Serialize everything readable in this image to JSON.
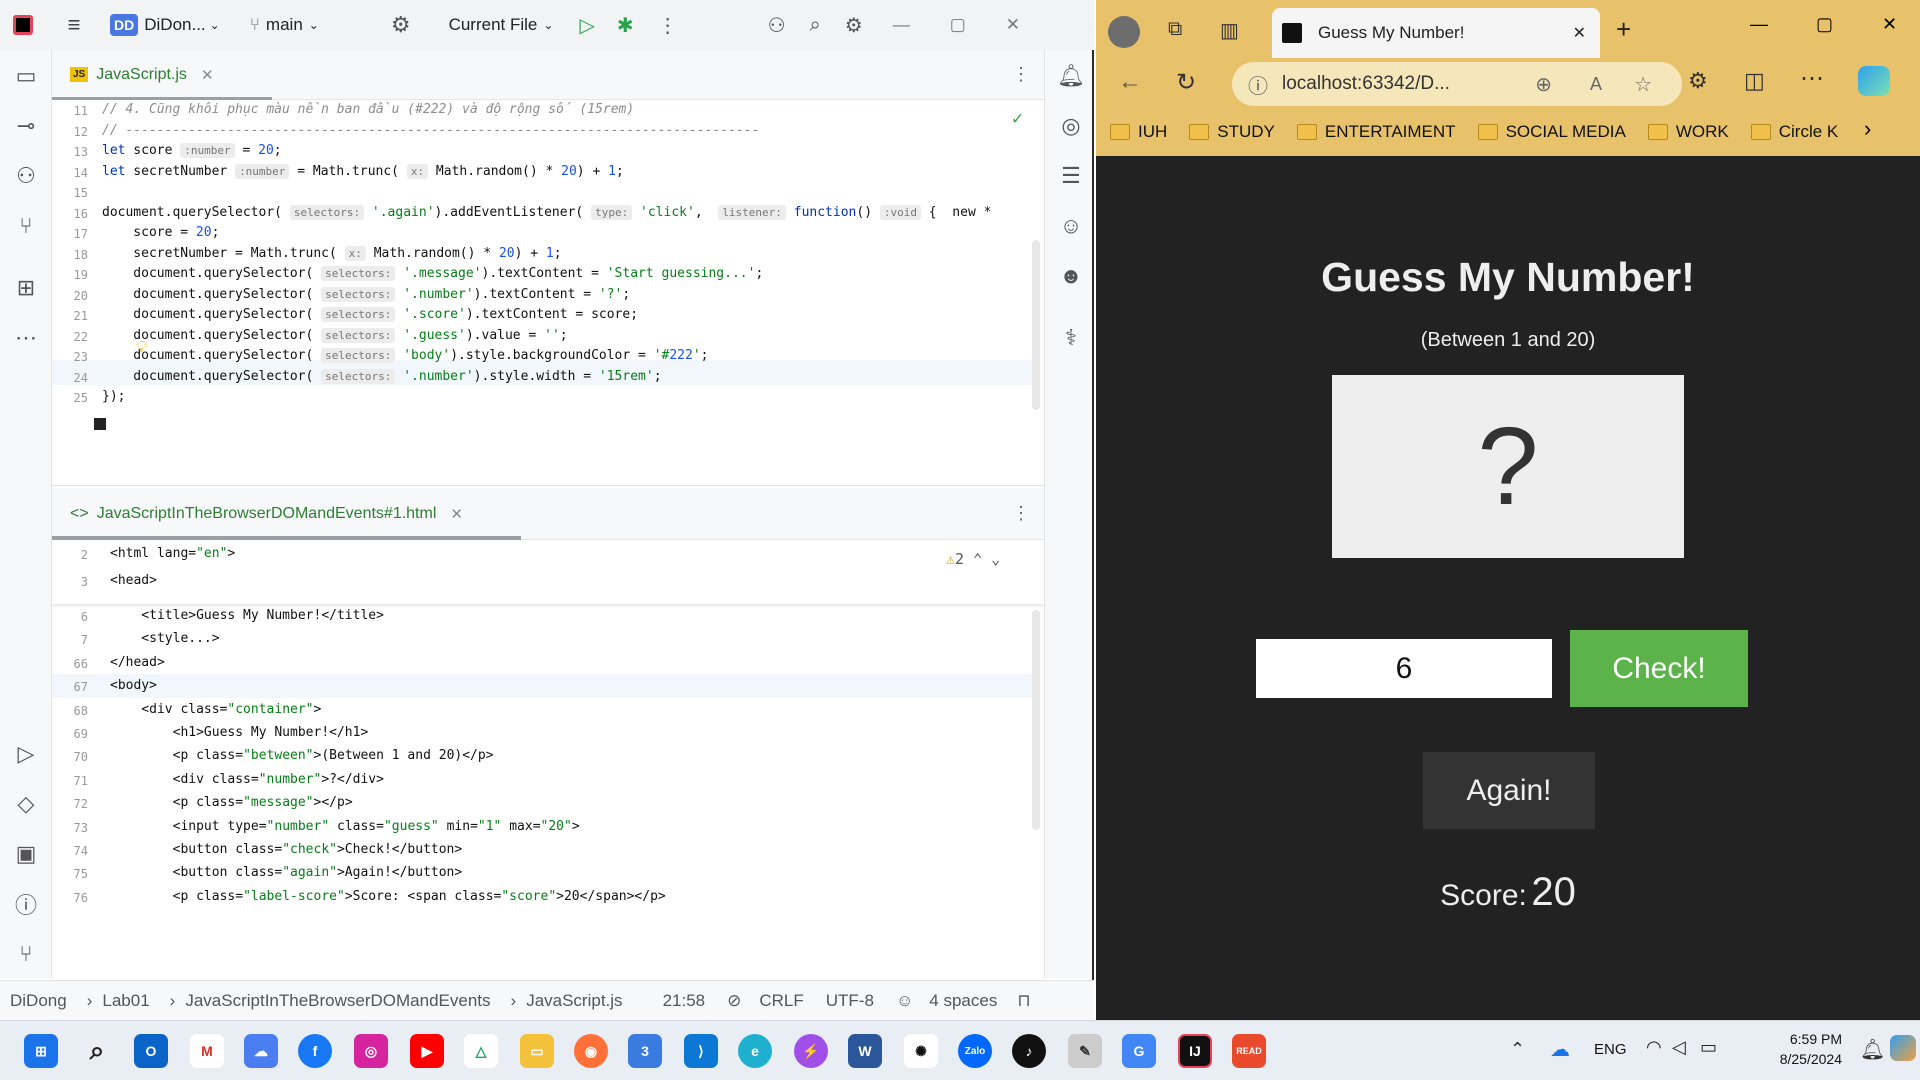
{
  "ide": {
    "project": "DiDon...",
    "project_badge": "DD",
    "branch": "main",
    "run_config": "Current File",
    "editor_tab": "JavaScript.js",
    "editor_tab_badge": "JS",
    "html_tab": "JavaScriptInTheBrowserDOMandEvents#1.html",
    "warnings": "2",
    "js_lines": [
      {
        "n": "11",
        "text": "// 4. Cũng khôi phục màu nền ban đầu (#222) và độ rộng số (15rem)"
      },
      {
        "n": "12",
        "text": "// ---------------------------------------------------------------------------------"
      },
      {
        "n": "13",
        "text": "let score :number = 20;"
      },
      {
        "n": "14",
        "text": "let secretNumber :number = Math.trunc( x: Math.random() * 20) + 1;"
      },
      {
        "n": "15",
        "text": ""
      },
      {
        "n": "16",
        "text": "document.querySelector( selectors: '.again').addEventListener( type: 'click',  listener: function() :void {  new *"
      },
      {
        "n": "17",
        "text": "    score = 20;"
      },
      {
        "n": "18",
        "text": "    secretNumber = Math.trunc( x: Math.random() * 20) + 1;"
      },
      {
        "n": "19",
        "text": "    document.querySelector( selectors: '.message').textContent = 'Start guessing...';"
      },
      {
        "n": "20",
        "text": "    document.querySelector( selectors: '.number').textContent = '?';"
      },
      {
        "n": "21",
        "text": "    document.querySelector( selectors: '.score').textContent = score;"
      },
      {
        "n": "22",
        "text": "    document.querySelector( selectors: '.guess').value = '';"
      },
      {
        "n": "23",
        "text": "    document.querySelector( selectors: 'body').style.backgroundColor = '#222';"
      },
      {
        "n": "24",
        "text": "    document.querySelector( selectors: '.number').style.width = '15rem';"
      },
      {
        "n": "25",
        "text": "});"
      }
    ],
    "html_lines": [
      {
        "n": "2",
        "text": "<html lang=\"en\">"
      },
      {
        "n": "3",
        "text": "<head>"
      },
      {
        "n": "6",
        "text": "    <title>Guess My Number!</title>"
      },
      {
        "n": "7",
        "text": "    <style...>"
      },
      {
        "n": "66",
        "text": "</head>"
      },
      {
        "n": "67",
        "text": "<body>"
      },
      {
        "n": "68",
        "text": "    <div class=\"container\">"
      },
      {
        "n": "69",
        "text": "        <h1>Guess My Number!</h1>"
      },
      {
        "n": "70",
        "text": "        <p class=\"between\">(Between 1 and 20)</p>"
      },
      {
        "n": "71",
        "text": "        <div class=\"number\">?</div>"
      },
      {
        "n": "72",
        "text": "        <p class=\"message\"></p>"
      },
      {
        "n": "73",
        "text": "        <input type=\"number\" class=\"guess\" min=\"1\" max=\"20\">"
      },
      {
        "n": "74",
        "text": "        <button class=\"check\">Check!</button>"
      },
      {
        "n": "75",
        "text": "        <button class=\"again\">Again!</button>"
      },
      {
        "n": "76",
        "text": "        <p class=\"label-score\">Score: <span class=\"score\">20</span></p>"
      }
    ],
    "status": {
      "crumbs": [
        "DiDong",
        "Lab01",
        "JavaScriptInTheBrowserDOMandEvents",
        "JavaScript.js"
      ],
      "pos": "21:58",
      "eol": "CRLF",
      "enc": "UTF-8",
      "indent": "4 spaces"
    }
  },
  "browser": {
    "tab_title": "Guess My Number!",
    "url": "localhost:63342/D...",
    "bookmarks": [
      "IUH",
      "STUDY",
      "ENTERTAIMENT",
      "SOCIAL MEDIA",
      "WORK",
      "Circle K"
    ],
    "page": {
      "title": "Guess My Number!",
      "between": "(Between 1 and 20)",
      "number": "?",
      "guess_value": "6",
      "check": "Check!",
      "again": "Again!",
      "score_label": "Score:",
      "score": "20"
    }
  },
  "taskbar": {
    "lang": "ENG",
    "time": "6:59 PM",
    "date": "8/25/2024"
  }
}
